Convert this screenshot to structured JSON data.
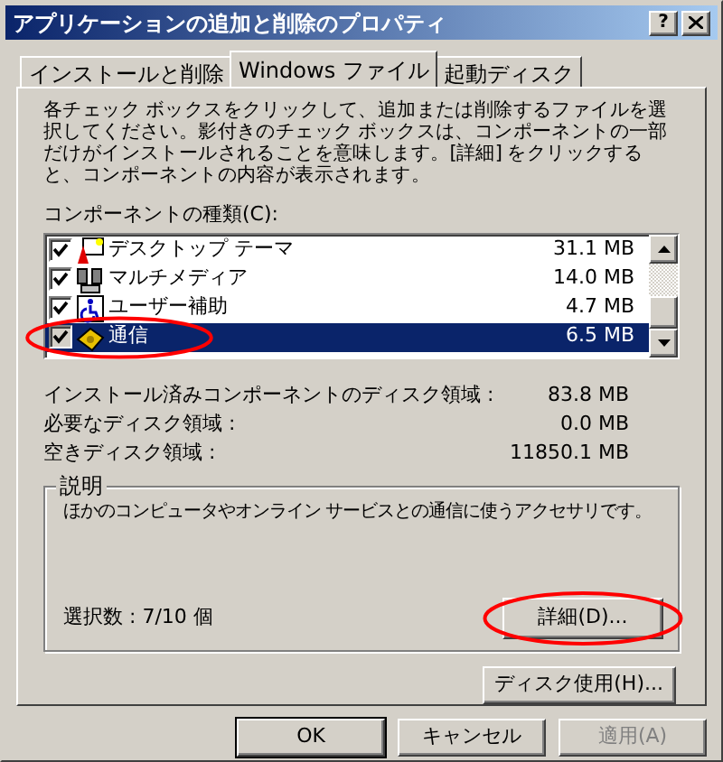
{
  "window": {
    "title": "アプリケーションの追加と削除のプロパティ",
    "help_button": "?"
  },
  "tabs": [
    {
      "label": "インストールと削除",
      "selected": false
    },
    {
      "label": "Windows ファイル",
      "selected": true
    },
    {
      "label": "起動ディスク",
      "selected": false
    }
  ],
  "instructions": "各チェック ボックスをクリックして、追加または削除するファイルを選択してください。影付きのチェック ボックスは、コンポーネントの一部だけがインストールされることを意味します。[詳細] をクリックすると、コンポーネントの内容が表示されます。",
  "components_label": "コンポーネントの種類(C):",
  "components": [
    {
      "name": "デスクトップ テーマ",
      "size": "31.1 MB",
      "checked": true,
      "selected": false,
      "circled": false,
      "kind": "theme"
    },
    {
      "name": "マルチメディア",
      "size": "14.0 MB",
      "checked": true,
      "selected": false,
      "circled": false,
      "kind": "media"
    },
    {
      "name": "ユーザー補助",
      "size": "4.7 MB",
      "checked": true,
      "selected": false,
      "circled": false,
      "kind": "access"
    },
    {
      "name": "通信",
      "size": "6.5 MB",
      "checked": true,
      "selected": true,
      "circled": true,
      "kind": "phone"
    }
  ],
  "disk_info": [
    {
      "label": "インストール済みコンポーネントのディスク領域 :",
      "value": "83.8 MB"
    },
    {
      "label": "必要なディスク領域 :",
      "value": "0.0 MB"
    },
    {
      "label": "空きディスク領域 :",
      "value": "11850.1 MB"
    }
  ],
  "description": {
    "title": "説明",
    "text": "ほかのコンピュータやオンライン サービスとの通信に使うアクセサリです。",
    "count": "選択数 : 7/10 個",
    "details_button": {
      "label": "詳細(D)...",
      "circled": true
    }
  },
  "disk_usage_button": "ディスク使用(H)...",
  "buttons": [
    {
      "label": "OK",
      "disabled": false,
      "default": true
    },
    {
      "label": "キャンセル",
      "disabled": false,
      "default": false
    },
    {
      "label": "適用(A)",
      "disabled": true,
      "default": false
    }
  ]
}
